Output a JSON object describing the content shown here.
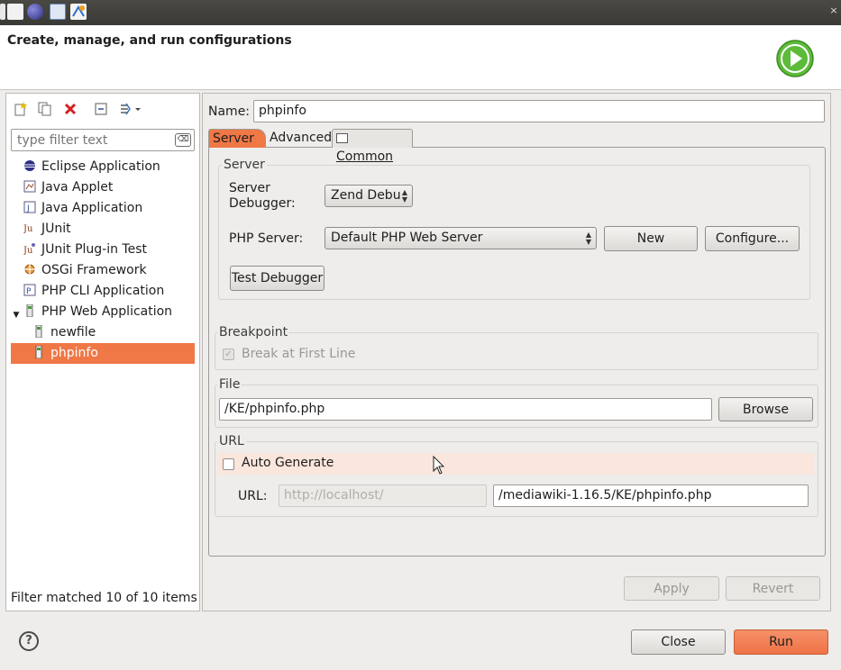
{
  "titlebar": {
    "close_glyph": "×"
  },
  "header": {
    "title": "Create, manage, and run configurations"
  },
  "left": {
    "filter_placeholder": "type filter text",
    "filter_clear_label": "⌫",
    "tree": [
      {
        "label": "Eclipse Application",
        "icon": "eclipse-icon"
      },
      {
        "label": "Java Applet",
        "icon": "java-applet-icon"
      },
      {
        "label": "Java Application",
        "icon": "java-application-icon"
      },
      {
        "label": "JUnit",
        "icon": "junit-icon"
      },
      {
        "label": "JUnit Plug-in Test",
        "icon": "junit-plugin-icon"
      },
      {
        "label": "OSGi Framework",
        "icon": "osgi-icon"
      },
      {
        "label": "PHP CLI Application",
        "icon": "php-cli-icon"
      },
      {
        "label": "PHP Web Application",
        "icon": "php-web-icon"
      },
      {
        "label": "newfile",
        "icon": "php-file-icon"
      },
      {
        "label": "phpinfo",
        "icon": "php-file-icon"
      }
    ],
    "status": "Filter matched 10 of 10 items"
  },
  "config": {
    "name_label": "Name:",
    "name_value": "phpinfo",
    "tabs": [
      "Server",
      "Advanced",
      "Common"
    ],
    "server_group": "Server",
    "debugger_label": "Server\nDebugger:",
    "debugger_value": "Zend Debu",
    "php_server_label": "PHP Server:",
    "php_server_value": "Default PHP Web Server",
    "new_button": "New",
    "configure_button": "Configure...",
    "test_debugger_button": "Test Debugger",
    "breakpoint_group": "Breakpoint",
    "break_first_line": "Break at First Line",
    "file_group": "File",
    "file_value": "/KE/phpinfo.php",
    "browse_button": "Browse",
    "url_group": "URL",
    "auto_generate": "Auto Generate",
    "url_label": "URL:",
    "url_base": "http://localhost/",
    "url_path": "/mediawiki-1.16.5/KE/phpinfo.php"
  },
  "buttons": {
    "apply": "Apply",
    "revert": "Revert",
    "close": "Close",
    "run": "Run",
    "help": "?"
  },
  "colors": {
    "accent": "#f07746",
    "auto_generate_bg": "#fbe6dd",
    "run_icon": "#5dbb3a"
  }
}
